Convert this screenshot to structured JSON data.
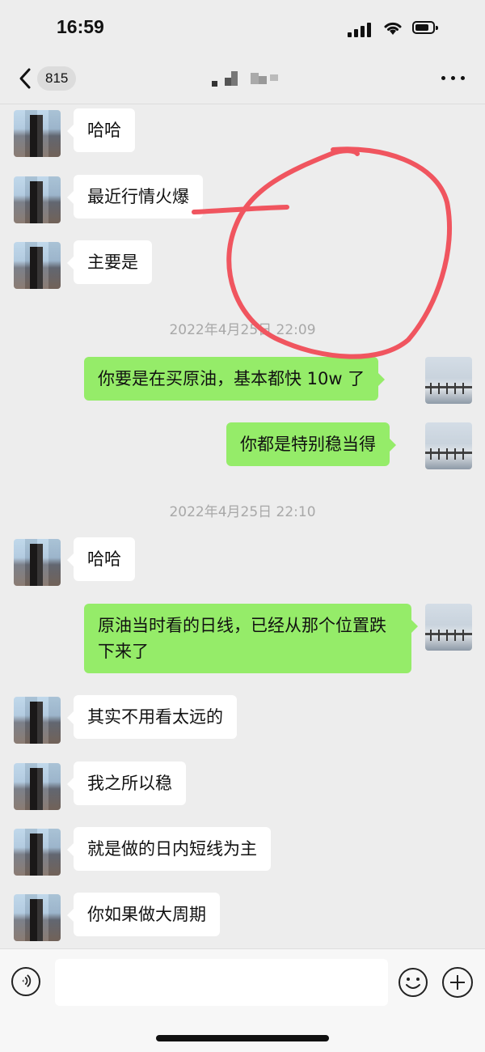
{
  "status_bar": {
    "time": "16:59"
  },
  "nav": {
    "back_count": "815"
  },
  "messages": [
    {
      "side": "left",
      "text": "哈哈"
    },
    {
      "side": "left",
      "text": "最近行情火爆"
    },
    {
      "side": "left",
      "text": "主要是"
    },
    {
      "timestamp": "2022年4月25日 22:09"
    },
    {
      "side": "right",
      "text": "你要是在买原油，基本都快 10w 了"
    },
    {
      "side": "right",
      "text": "你都是特别稳当得"
    },
    {
      "timestamp": "2022年4月25日 22:10"
    },
    {
      "side": "left",
      "text": "哈哈"
    },
    {
      "side": "right",
      "text": "原油当时看的日线，已经从那个位置跌下来了"
    },
    {
      "side": "left",
      "text": "其实不用看太远的"
    },
    {
      "side": "left",
      "text": "我之所以稳"
    },
    {
      "side": "left",
      "text": "就是做的日内短线为主"
    },
    {
      "side": "left",
      "text": "你如果做大周期"
    }
  ],
  "input": {
    "placeholder": ""
  },
  "colors": {
    "background": "#ededed",
    "own_bubble": "#95ec69",
    "other_bubble": "#ffffff",
    "annotation": "#f0555f"
  },
  "icons": [
    "back-icon",
    "more-icon",
    "voice-icon",
    "emoji-icon",
    "plus-icon"
  ]
}
